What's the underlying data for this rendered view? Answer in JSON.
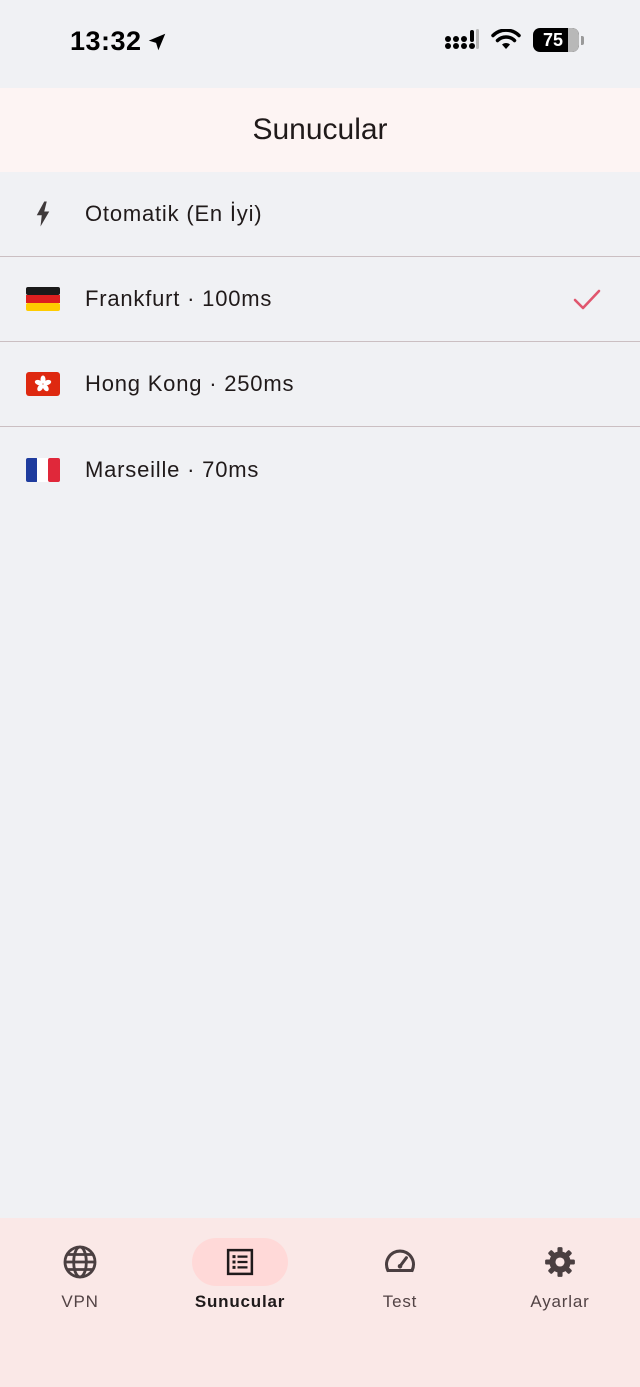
{
  "status_bar": {
    "time": "13:32",
    "battery": "75"
  },
  "header": {
    "title": "Sunucular"
  },
  "servers": [
    {
      "label": "Otomatik (En İyi)",
      "icon": "bolt-icon",
      "selected": false
    },
    {
      "label": "Frankfurt · 100ms",
      "icon": "flag-germany-icon",
      "selected": true
    },
    {
      "label": "Hong Kong · 250ms",
      "icon": "flag-hong-kong-icon",
      "selected": false
    },
    {
      "label": "Marseille · 70ms",
      "icon": "flag-france-icon",
      "selected": false
    }
  ],
  "bottom_nav": {
    "items": [
      {
        "label": "VPN",
        "icon": "globe-icon",
        "active": false
      },
      {
        "label": "Sunucular",
        "icon": "list-icon",
        "active": true
      },
      {
        "label": "Test",
        "icon": "speedometer-icon",
        "active": false
      },
      {
        "label": "Ayarlar",
        "icon": "gear-icon",
        "active": false
      }
    ]
  },
  "colors": {
    "background": "#f0f1f4",
    "header_background": "#fdf4f3",
    "nav_background": "#fae8e7",
    "active_pill": "#ffd9d8",
    "check_accent": "#e0566e",
    "divider": "#cbbfc2"
  }
}
